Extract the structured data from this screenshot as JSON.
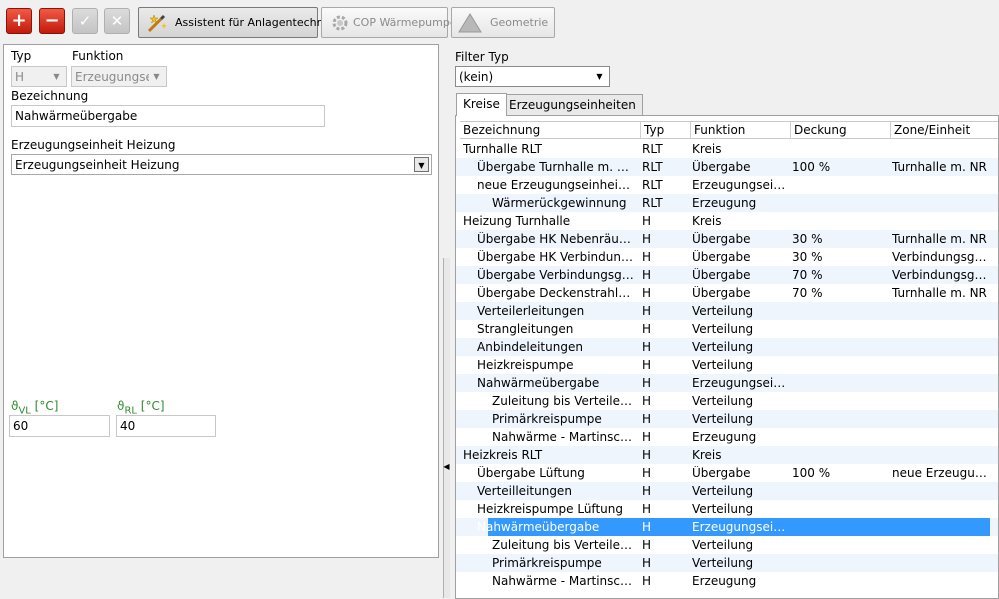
{
  "toolbar": {
    "assistant_label": "Assistent für Anlagentechnik",
    "cop_label": "COP Wärmepumpe",
    "geometry_label": "Geometrie"
  },
  "form": {
    "typ_label": "Typ",
    "typ_value": "H",
    "funktion_label": "Funktion",
    "funktion_value": "Erzeugungsei",
    "bezeichnung_label": "Bezeichnung",
    "bezeichnung_value": "Nahwärmeübergabe",
    "erzeugung_label": "Erzeugungseinheit Heizung",
    "erzeugung_value": "Erzeugungseinheit Heizung",
    "vl_symbol": "ϑ",
    "vl_sub": "VL",
    "vl_unit": " [°C]",
    "vl_value": "60",
    "rl_symbol": "ϑ",
    "rl_sub": "RL",
    "rl_unit": " [°C]",
    "rl_value": "40"
  },
  "filter": {
    "label": "Filter Typ",
    "value": "(kein)"
  },
  "tabs": [
    "Kreise",
    "Erzeugungseinheiten"
  ],
  "tree": {
    "columns": [
      "Bezeichnung",
      "Typ",
      "Funktion",
      "Deckung",
      "Zone/Einheit"
    ],
    "rows": [
      {
        "name": "Turnhalle RLT",
        "typ": "RLT",
        "funktion": "Kreis",
        "deckung": "",
        "zone": "",
        "level": 0
      },
      {
        "name": "Übergabe Turnhalle m. NR",
        "typ": "RLT",
        "funktion": "Übergabe",
        "deckung": "100 %",
        "zone": "Turnhalle m. NR",
        "level": 1
      },
      {
        "name": "neue Erzeugungseinheit RLT",
        "typ": "RLT",
        "funktion": "Erzeugungsein...",
        "deckung": "",
        "zone": "",
        "level": 1
      },
      {
        "name": "Wärmerückgewinnung",
        "typ": "RLT",
        "funktion": "Erzeugung",
        "deckung": "",
        "zone": "",
        "level": 2
      },
      {
        "name": "Heizung Turnhalle",
        "typ": "H",
        "funktion": "Kreis",
        "deckung": "",
        "zone": "",
        "level": 0
      },
      {
        "name": "Übergabe HK Nebenräume",
        "typ": "H",
        "funktion": "Übergabe",
        "deckung": "30 %",
        "zone": "Turnhalle m. NR",
        "level": 1
      },
      {
        "name": "Übergabe HK Verbindungs...",
        "typ": "H",
        "funktion": "Übergabe",
        "deckung": "30 %",
        "zone": "Verbindungsgang",
        "level": 1
      },
      {
        "name": "Übergabe Verbindungsgang",
        "typ": "H",
        "funktion": "Übergabe",
        "deckung": "70 %",
        "zone": "Verbindungsgang",
        "level": 1
      },
      {
        "name": "Übergabe Deckenstrahlheiz...",
        "typ": "H",
        "funktion": "Übergabe",
        "deckung": "70 %",
        "zone": "Turnhalle m. NR",
        "level": 1
      },
      {
        "name": "Verteilerleitungen",
        "typ": "H",
        "funktion": "Verteilung",
        "deckung": "",
        "zone": "",
        "level": 1
      },
      {
        "name": "Strangleitungen",
        "typ": "H",
        "funktion": "Verteilung",
        "deckung": "",
        "zone": "",
        "level": 1
      },
      {
        "name": "Anbindeleitungen",
        "typ": "H",
        "funktion": "Verteilung",
        "deckung": "",
        "zone": "",
        "level": 1
      },
      {
        "name": "Heizkreispumpe",
        "typ": "H",
        "funktion": "Verteilung",
        "deckung": "",
        "zone": "",
        "level": 1
      },
      {
        "name": "Nahwärmeübergabe",
        "typ": "H",
        "funktion": "Erzeugungsein...",
        "deckung": "",
        "zone": "",
        "level": 1
      },
      {
        "name": "Zuleitung bis Verteiler M...",
        "typ": "H",
        "funktion": "Verteilung",
        "deckung": "",
        "zone": "",
        "level": 2
      },
      {
        "name": "Primärkreispumpe",
        "typ": "H",
        "funktion": "Verteilung",
        "deckung": "",
        "zone": "",
        "level": 2
      },
      {
        "name": "Nahwärme - Martinschule",
        "typ": "H",
        "funktion": "Erzeugung",
        "deckung": "",
        "zone": "",
        "level": 2
      },
      {
        "name": "Heizkreis RLT",
        "typ": "H",
        "funktion": "Kreis",
        "deckung": "",
        "zone": "",
        "level": 0
      },
      {
        "name": "Übergabe Lüftung",
        "typ": "H",
        "funktion": "Übergabe",
        "deckung": "100 %",
        "zone": "neue Erzeugun...",
        "level": 1
      },
      {
        "name": "Verteilleitungen",
        "typ": "H",
        "funktion": "Verteilung",
        "deckung": "",
        "zone": "",
        "level": 1
      },
      {
        "name": "Heizkreispumpe Lüftung",
        "typ": "H",
        "funktion": "Verteilung",
        "deckung": "",
        "zone": "",
        "level": 1
      },
      {
        "name": "Nahwärmeübergabe",
        "typ": "H",
        "funktion": "Erzeugungsein...",
        "deckung": "",
        "zone": "",
        "level": 1,
        "selected": true
      },
      {
        "name": "Zuleitung bis Verteiler M...",
        "typ": "H",
        "funktion": "Verteilung",
        "deckung": "",
        "zone": "",
        "level": 2
      },
      {
        "name": "Primärkreispumpe",
        "typ": "H",
        "funktion": "Verteilung",
        "deckung": "",
        "zone": "",
        "level": 2
      },
      {
        "name": "Nahwärme - Martinschule",
        "typ": "H",
        "funktion": "Erzeugung",
        "deckung": "",
        "zone": "",
        "level": 2
      }
    ]
  },
  "colors": {
    "selection": "#3399ff",
    "row_alt": "#eef5fd",
    "accent_red": "#d9261a",
    "label_green": "#2e8b2e"
  },
  "icons": {
    "add": "plus-icon",
    "remove": "minus-icon",
    "confirm": "check-icon",
    "cancel": "close-icon",
    "assistant": "wand-icon",
    "cop": "gear-icon",
    "geometry": "triangle-icon",
    "splitter": "chevron-left-icon"
  }
}
